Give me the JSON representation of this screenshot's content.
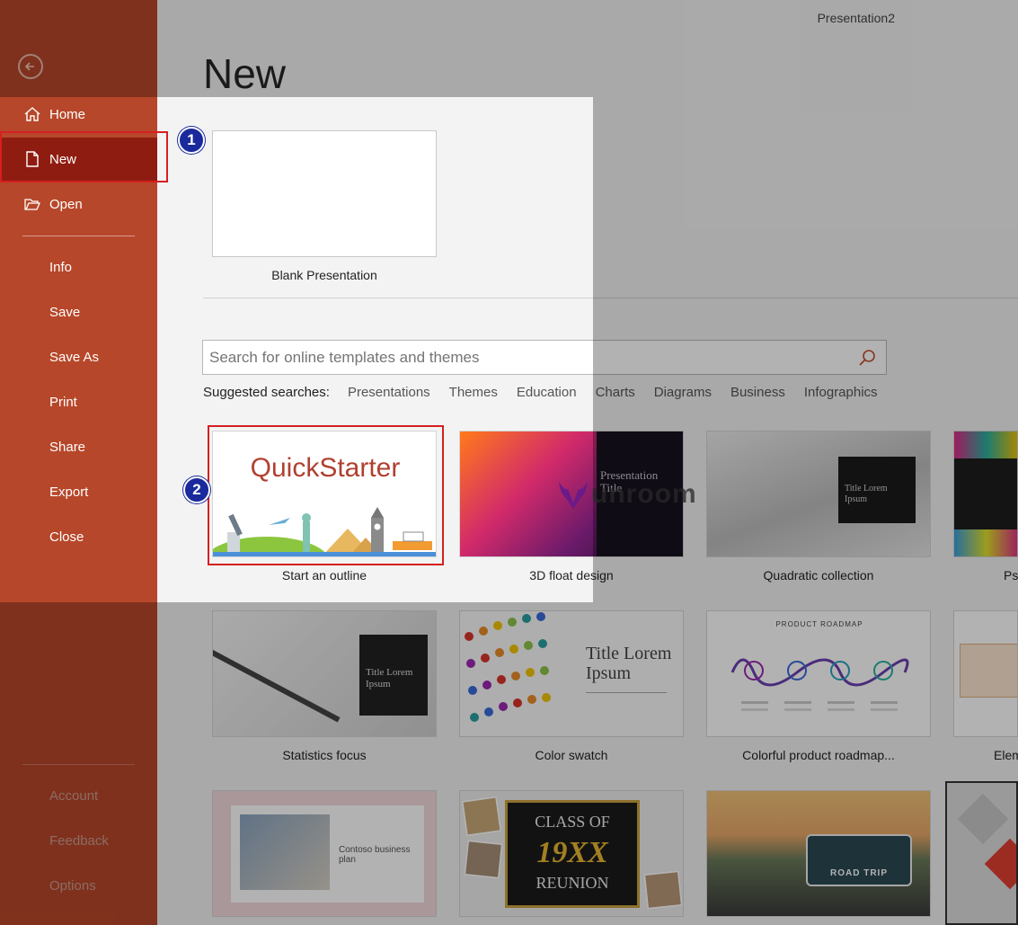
{
  "window": {
    "doc_title": "Presentation2"
  },
  "sidebar": {
    "items": [
      {
        "label": "Home",
        "icon": "home-icon"
      },
      {
        "label": "New",
        "icon": "new-document-icon"
      },
      {
        "label": "Open",
        "icon": "open-folder-icon"
      },
      {
        "label": "Info"
      },
      {
        "label": "Save"
      },
      {
        "label": "Save As"
      },
      {
        "label": "Print"
      },
      {
        "label": "Share"
      },
      {
        "label": "Export"
      },
      {
        "label": "Close"
      }
    ],
    "footer": [
      "Account",
      "Feedback",
      "Options"
    ]
  },
  "main": {
    "title": "New",
    "blank_label": "Blank Presentation",
    "search_placeholder": "Search for online templates and themes",
    "suggested_label": "Suggested searches:",
    "suggestions": [
      "Presentations",
      "Themes",
      "Education",
      "Charts",
      "Diagrams",
      "Business",
      "Infographics"
    ],
    "templates": [
      {
        "label": "Start an outline",
        "thumb_text": "QuickStarter"
      },
      {
        "label": "3D float design",
        "thumb_text": "Presentation Title"
      },
      {
        "label": "Quadratic collection",
        "thumb_text": "Title Lorem Ipsum"
      },
      {
        "label": "Ps"
      },
      {
        "label": "Statistics focus",
        "thumb_text": "Title Lorem Ipsum"
      },
      {
        "label": "Color swatch",
        "thumb_text": "Title Lorem Ipsum"
      },
      {
        "label": "Colorful product roadmap...",
        "thumb_text": "PRODUCT ROADMAP"
      },
      {
        "label": "Eleme"
      },
      {
        "thumb_text": "Contoso business plan"
      },
      {
        "thumb_text": "CLASS OF",
        "thumb_text2": "19XX",
        "thumb_text3": "REUNION"
      },
      {
        "thumb_text": "ROAD TRIP"
      }
    ]
  },
  "annotations": {
    "step1": "1",
    "step2": "2"
  },
  "watermark": "unroom",
  "colors": {
    "sidebar": "#b7472a",
    "active": "#8f1c10",
    "highlight": "#d42020",
    "badge": "#1a2a9c"
  }
}
